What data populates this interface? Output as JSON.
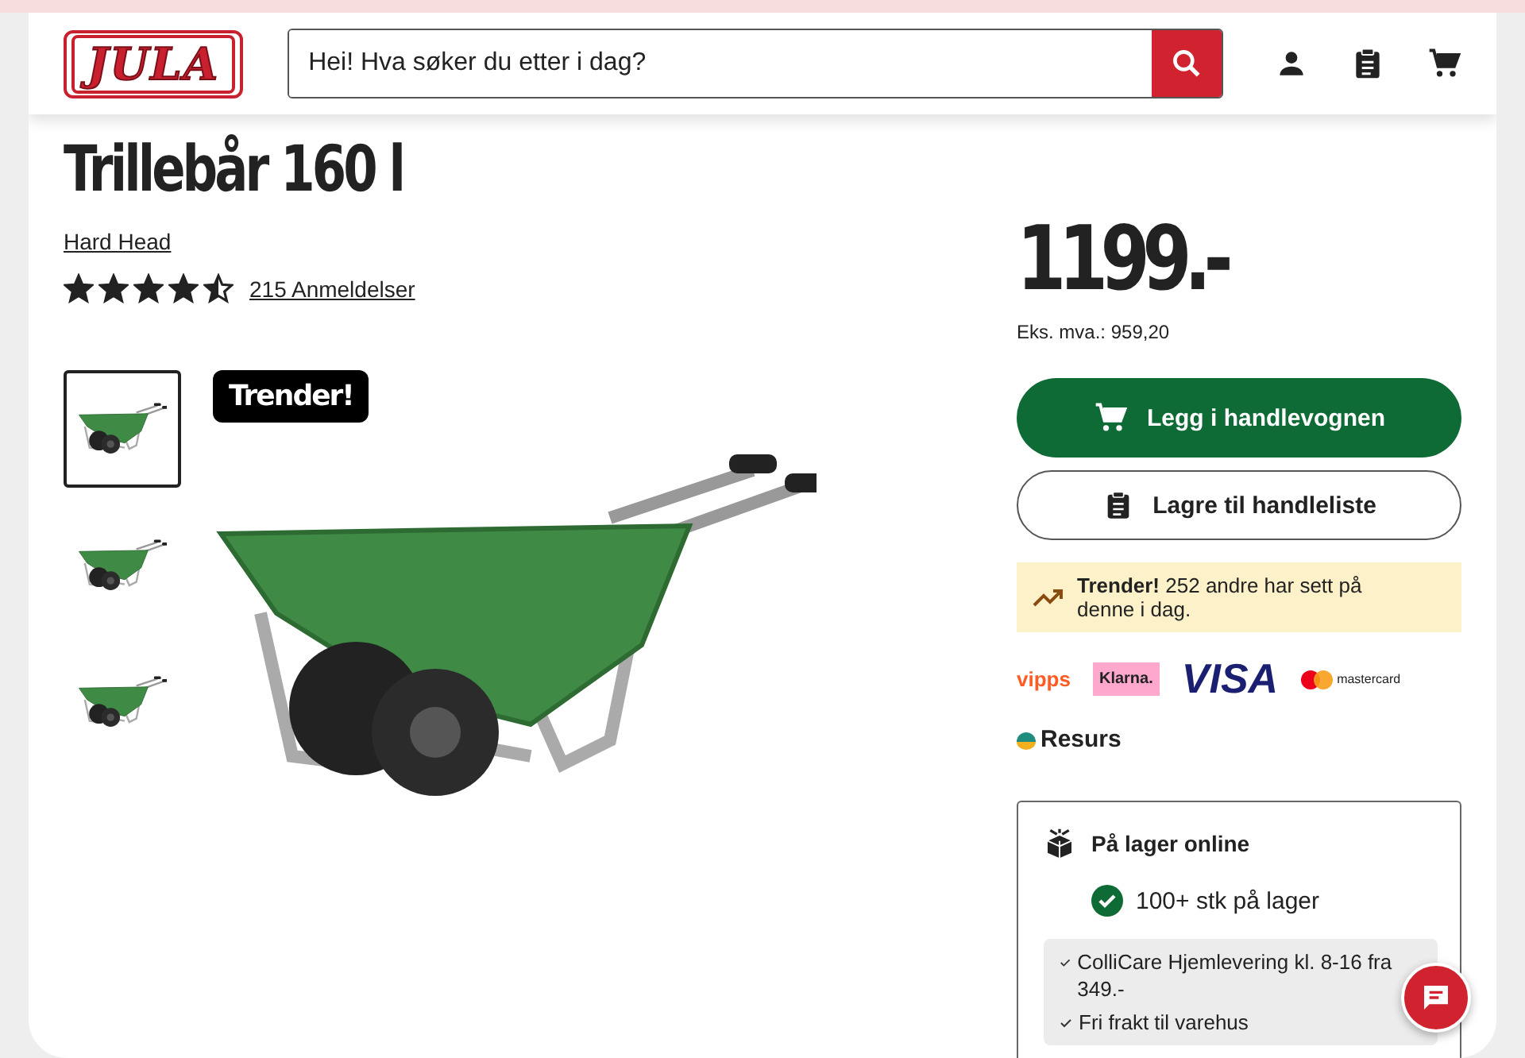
{
  "header": {
    "logo": "JULA",
    "search": {
      "placeholder": "Hei! Hva søker du etter i dag?"
    }
  },
  "product": {
    "title": "Trillebår 160 l",
    "brand": "Hard Head",
    "stars": 4.5,
    "reviews": "215 Anmeldelser",
    "badge": "Trender!",
    "thumbnails": [
      {
        "selected": true
      },
      {
        "selected": false
      },
      {
        "selected": false
      }
    ]
  },
  "purchase": {
    "price": "1199.-",
    "ex_vat": "Eks. mva.: 959,20",
    "add_to_cart": "Legg i handlevognen",
    "save_to_list": "Lagre til handleliste",
    "trend": {
      "bold": "Trender!",
      "text": "252 andre har sett på denne i dag."
    },
    "payments": [
      "vipps",
      "Klarna.",
      "VISA",
      "mastercard",
      "Resurs"
    ],
    "stock": {
      "title": "På lager online",
      "status": "100+ stk på lager",
      "in_stock": true,
      "delivery": [
        "ColliCare Hjemlevering kl. 8-16 fra 349.-",
        "Fri frakt til varehus"
      ]
    }
  }
}
